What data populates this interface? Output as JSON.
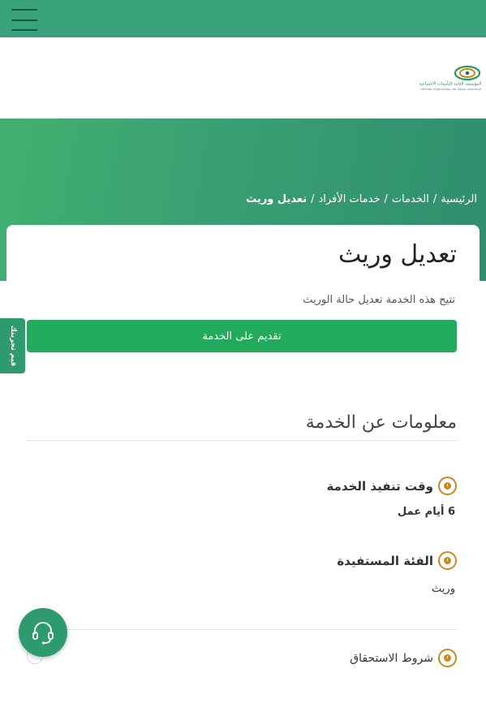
{
  "header": {
    "menu_icon": "hamburger-icon",
    "logo": {
      "arabic": "المؤسسة العامة للتأمينات الاجتماعية",
      "english": "General Organization for Social Insurance"
    }
  },
  "breadcrumb": {
    "items": [
      "الرئيسية",
      "الخدمات",
      "خدمات الأفراد"
    ],
    "separator": "/",
    "current": "تعديل وريث"
  },
  "page": {
    "title": "تعديل وريث",
    "description": "تتيح هذه الخدمة تعديل حالة الوريث",
    "apply_button": "تقديم على الخدمة"
  },
  "side_tab": {
    "label": "قيم تجربتك"
  },
  "service_info": {
    "title": "معلومات عن الخدمة",
    "items": [
      {
        "label": "وقت تنفيذ الخدمة",
        "value": "6 أيام عمل",
        "icon": "clock-icon"
      },
      {
        "label": "الفئة المستفيدة",
        "value": "وريث",
        "icon": "clock-icon"
      },
      {
        "label": "شروط الاستحقاق",
        "value": "",
        "icon": "clock-icon"
      }
    ]
  },
  "support_button": {
    "icon": "headset-icon"
  },
  "colors": {
    "topbar": "#3aa27a",
    "hero_start": "#41b06f",
    "hero_end": "#2f8e6d",
    "primary_button": "#22ab5c",
    "icon_accent": "#c58a22"
  }
}
